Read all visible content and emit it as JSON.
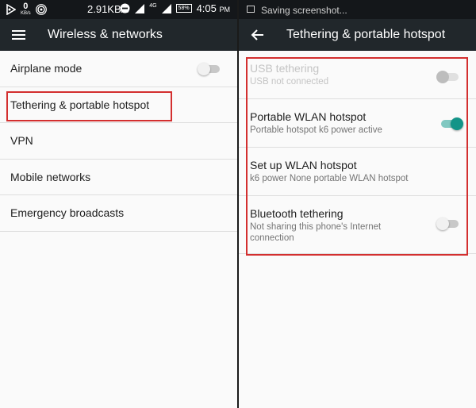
{
  "left": {
    "status": {
      "net_zero": "0",
      "net_unit": "KB/s",
      "speed": "2.91KB/s",
      "four_g": "4G",
      "battery": "58%",
      "time": "4:05",
      "ampm": "PM"
    },
    "appbar": {
      "title": "Wireless & networks",
      "nav_icon": "hamburger-menu-icon"
    },
    "items": [
      {
        "label": "Airplane mode",
        "toggle": "off"
      },
      {
        "label": "Tethering & portable hotspot"
      },
      {
        "label": "VPN"
      },
      {
        "label": "Mobile networks"
      },
      {
        "label": "Emergency broadcasts"
      }
    ]
  },
  "right": {
    "status": {
      "text": "Saving screenshot..."
    },
    "appbar": {
      "title": "Tethering & portable hotspot",
      "nav_icon": "back-arrow-icon"
    },
    "items": [
      {
        "label": "USB tethering",
        "sub": "USB not connected",
        "state": "disabled-off"
      },
      {
        "label": "Portable WLAN hotspot",
        "sub": "Portable hotspot k6 power active",
        "state": "on"
      },
      {
        "label": "Set up WLAN hotspot",
        "sub": "k6 power None portable WLAN hotspot"
      },
      {
        "label": "Bluetooth tethering",
        "sub": "Not sharing this phone's Internet connection",
        "state": "off"
      }
    ]
  },
  "colors": {
    "appbar": "#21272b",
    "statusbar": "#14171a",
    "accent_teal": "#139488",
    "highlight_red": "#d32f2f"
  }
}
